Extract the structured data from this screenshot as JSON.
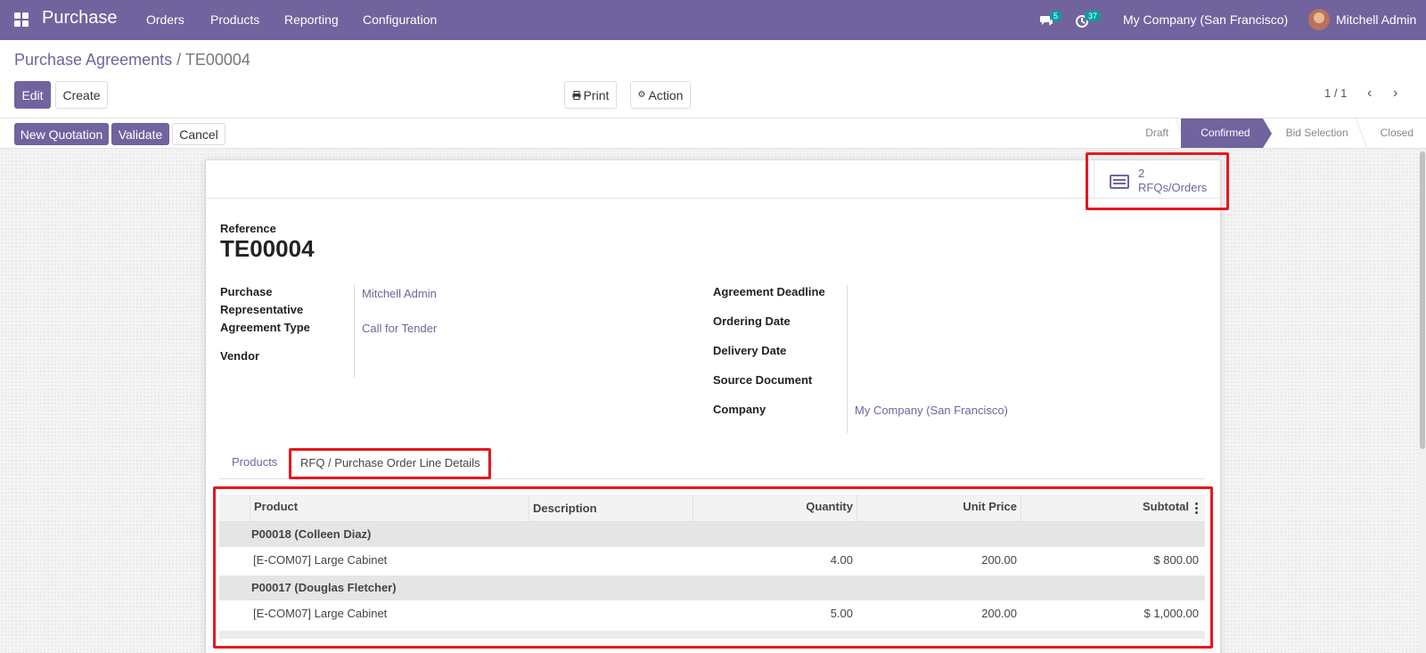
{
  "navbar": {
    "app_name": "Purchase",
    "menu": [
      "Orders",
      "Products",
      "Reporting",
      "Configuration"
    ],
    "messages_count": "5",
    "activities_count": "37",
    "company": "My Company (San Francisco)",
    "user": "Mitchell Admin"
  },
  "breadcrumb": {
    "parent": "Purchase Agreements",
    "separator": "/",
    "current": "TE00004"
  },
  "toolbar": {
    "edit": "Edit",
    "create": "Create",
    "print": "Print",
    "action": "Action",
    "pager": "1 / 1"
  },
  "header_buttons": {
    "new_quotation": "New Quotation",
    "validate": "Validate",
    "cancel": "Cancel"
  },
  "status": {
    "steps": [
      "Draft",
      "Confirmed",
      "Bid Selection",
      "Closed"
    ],
    "active": "Confirmed"
  },
  "smart_button": {
    "count": "2",
    "label": "RFQs/Orders"
  },
  "form": {
    "reference_label": "Reference",
    "reference": "TE00004",
    "left_fields": [
      {
        "label": "Purchase Representative",
        "value": "Mitchell Admin"
      },
      {
        "label": "Agreement Type",
        "value": "Call for Tender"
      },
      {
        "label": "Vendor",
        "value": ""
      }
    ],
    "right_fields": [
      {
        "label": "Agreement Deadline",
        "value": ""
      },
      {
        "label": "Ordering Date",
        "value": ""
      },
      {
        "label": "Delivery Date",
        "value": ""
      },
      {
        "label": "Source Document",
        "value": ""
      },
      {
        "label": "Company",
        "value": "My Company (San Francisco)"
      }
    ]
  },
  "tabs": [
    "Products",
    "RFQ / Purchase Order Line Details"
  ],
  "table": {
    "headers": [
      "Product",
      "Description",
      "Quantity",
      "Unit Price",
      "Subtotal"
    ],
    "groups": [
      {
        "name": "P00018 (Colleen Diaz)",
        "rows": [
          {
            "product": "[E-COM07] Large Cabinet",
            "description": "",
            "quantity": "4.00",
            "unit_price": "200.00",
            "subtotal": "$ 800.00"
          }
        ]
      },
      {
        "name": "P00017 (Douglas Fletcher)",
        "rows": [
          {
            "product": "[E-COM07] Large Cabinet",
            "description": "",
            "quantity": "5.00",
            "unit_price": "200.00",
            "subtotal": "$ 1,000.00"
          }
        ]
      }
    ]
  },
  "icons": {
    "apps": "apps-grid-icon",
    "messages": "chat-icon",
    "activities": "clock-icon",
    "print": "printer-icon",
    "action": "gear-icon",
    "prev": "chevron-left-icon",
    "next": "chevron-right-icon",
    "smart": "list-icon",
    "optional_columns": "kebab-menu-icon"
  },
  "colors": {
    "brand": "#71639e",
    "badge": "#00a09d",
    "highlight": "#e8171c"
  }
}
